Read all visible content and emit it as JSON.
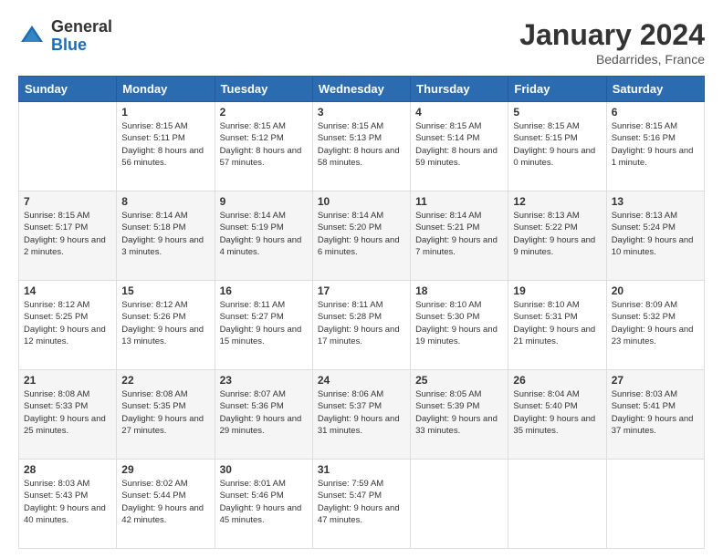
{
  "header": {
    "logo_general": "General",
    "logo_blue": "Blue",
    "month_title": "January 2024",
    "location": "Bedarrides, France"
  },
  "days_of_week": [
    "Sunday",
    "Monday",
    "Tuesday",
    "Wednesday",
    "Thursday",
    "Friday",
    "Saturday"
  ],
  "weeks": [
    [
      {
        "day": "",
        "sunrise": "",
        "sunset": "",
        "daylight": ""
      },
      {
        "day": "1",
        "sunrise": "Sunrise: 8:15 AM",
        "sunset": "Sunset: 5:11 PM",
        "daylight": "Daylight: 8 hours and 56 minutes."
      },
      {
        "day": "2",
        "sunrise": "Sunrise: 8:15 AM",
        "sunset": "Sunset: 5:12 PM",
        "daylight": "Daylight: 8 hours and 57 minutes."
      },
      {
        "day": "3",
        "sunrise": "Sunrise: 8:15 AM",
        "sunset": "Sunset: 5:13 PM",
        "daylight": "Daylight: 8 hours and 58 minutes."
      },
      {
        "day": "4",
        "sunrise": "Sunrise: 8:15 AM",
        "sunset": "Sunset: 5:14 PM",
        "daylight": "Daylight: 8 hours and 59 minutes."
      },
      {
        "day": "5",
        "sunrise": "Sunrise: 8:15 AM",
        "sunset": "Sunset: 5:15 PM",
        "daylight": "Daylight: 9 hours and 0 minutes."
      },
      {
        "day": "6",
        "sunrise": "Sunrise: 8:15 AM",
        "sunset": "Sunset: 5:16 PM",
        "daylight": "Daylight: 9 hours and 1 minute."
      }
    ],
    [
      {
        "day": "7",
        "sunrise": "Sunrise: 8:15 AM",
        "sunset": "Sunset: 5:17 PM",
        "daylight": "Daylight: 9 hours and 2 minutes."
      },
      {
        "day": "8",
        "sunrise": "Sunrise: 8:14 AM",
        "sunset": "Sunset: 5:18 PM",
        "daylight": "Daylight: 9 hours and 3 minutes."
      },
      {
        "day": "9",
        "sunrise": "Sunrise: 8:14 AM",
        "sunset": "Sunset: 5:19 PM",
        "daylight": "Daylight: 9 hours and 4 minutes."
      },
      {
        "day": "10",
        "sunrise": "Sunrise: 8:14 AM",
        "sunset": "Sunset: 5:20 PM",
        "daylight": "Daylight: 9 hours and 6 minutes."
      },
      {
        "day": "11",
        "sunrise": "Sunrise: 8:14 AM",
        "sunset": "Sunset: 5:21 PM",
        "daylight": "Daylight: 9 hours and 7 minutes."
      },
      {
        "day": "12",
        "sunrise": "Sunrise: 8:13 AM",
        "sunset": "Sunset: 5:22 PM",
        "daylight": "Daylight: 9 hours and 9 minutes."
      },
      {
        "day": "13",
        "sunrise": "Sunrise: 8:13 AM",
        "sunset": "Sunset: 5:24 PM",
        "daylight": "Daylight: 9 hours and 10 minutes."
      }
    ],
    [
      {
        "day": "14",
        "sunrise": "Sunrise: 8:12 AM",
        "sunset": "Sunset: 5:25 PM",
        "daylight": "Daylight: 9 hours and 12 minutes."
      },
      {
        "day": "15",
        "sunrise": "Sunrise: 8:12 AM",
        "sunset": "Sunset: 5:26 PM",
        "daylight": "Daylight: 9 hours and 13 minutes."
      },
      {
        "day": "16",
        "sunrise": "Sunrise: 8:11 AM",
        "sunset": "Sunset: 5:27 PM",
        "daylight": "Daylight: 9 hours and 15 minutes."
      },
      {
        "day": "17",
        "sunrise": "Sunrise: 8:11 AM",
        "sunset": "Sunset: 5:28 PM",
        "daylight": "Daylight: 9 hours and 17 minutes."
      },
      {
        "day": "18",
        "sunrise": "Sunrise: 8:10 AM",
        "sunset": "Sunset: 5:30 PM",
        "daylight": "Daylight: 9 hours and 19 minutes."
      },
      {
        "day": "19",
        "sunrise": "Sunrise: 8:10 AM",
        "sunset": "Sunset: 5:31 PM",
        "daylight": "Daylight: 9 hours and 21 minutes."
      },
      {
        "day": "20",
        "sunrise": "Sunrise: 8:09 AM",
        "sunset": "Sunset: 5:32 PM",
        "daylight": "Daylight: 9 hours and 23 minutes."
      }
    ],
    [
      {
        "day": "21",
        "sunrise": "Sunrise: 8:08 AM",
        "sunset": "Sunset: 5:33 PM",
        "daylight": "Daylight: 9 hours and 25 minutes."
      },
      {
        "day": "22",
        "sunrise": "Sunrise: 8:08 AM",
        "sunset": "Sunset: 5:35 PM",
        "daylight": "Daylight: 9 hours and 27 minutes."
      },
      {
        "day": "23",
        "sunrise": "Sunrise: 8:07 AM",
        "sunset": "Sunset: 5:36 PM",
        "daylight": "Daylight: 9 hours and 29 minutes."
      },
      {
        "day": "24",
        "sunrise": "Sunrise: 8:06 AM",
        "sunset": "Sunset: 5:37 PM",
        "daylight": "Daylight: 9 hours and 31 minutes."
      },
      {
        "day": "25",
        "sunrise": "Sunrise: 8:05 AM",
        "sunset": "Sunset: 5:39 PM",
        "daylight": "Daylight: 9 hours and 33 minutes."
      },
      {
        "day": "26",
        "sunrise": "Sunrise: 8:04 AM",
        "sunset": "Sunset: 5:40 PM",
        "daylight": "Daylight: 9 hours and 35 minutes."
      },
      {
        "day": "27",
        "sunrise": "Sunrise: 8:03 AM",
        "sunset": "Sunset: 5:41 PM",
        "daylight": "Daylight: 9 hours and 37 minutes."
      }
    ],
    [
      {
        "day": "28",
        "sunrise": "Sunrise: 8:03 AM",
        "sunset": "Sunset: 5:43 PM",
        "daylight": "Daylight: 9 hours and 40 minutes."
      },
      {
        "day": "29",
        "sunrise": "Sunrise: 8:02 AM",
        "sunset": "Sunset: 5:44 PM",
        "daylight": "Daylight: 9 hours and 42 minutes."
      },
      {
        "day": "30",
        "sunrise": "Sunrise: 8:01 AM",
        "sunset": "Sunset: 5:46 PM",
        "daylight": "Daylight: 9 hours and 45 minutes."
      },
      {
        "day": "31",
        "sunrise": "Sunrise: 7:59 AM",
        "sunset": "Sunset: 5:47 PM",
        "daylight": "Daylight: 9 hours and 47 minutes."
      },
      {
        "day": "",
        "sunrise": "",
        "sunset": "",
        "daylight": ""
      },
      {
        "day": "",
        "sunrise": "",
        "sunset": "",
        "daylight": ""
      },
      {
        "day": "",
        "sunrise": "",
        "sunset": "",
        "daylight": ""
      }
    ]
  ]
}
